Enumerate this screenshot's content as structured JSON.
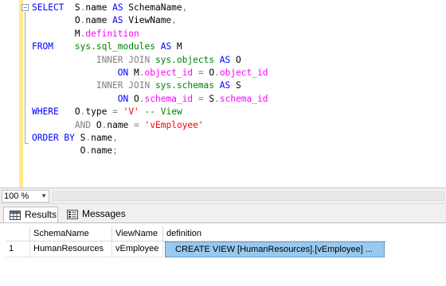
{
  "editor": {
    "lines": [
      [
        {
          "t": "SELECT",
          "c": "kw"
        },
        {
          "t": "  S",
          "c": "id"
        },
        {
          "t": ".",
          "c": "op"
        },
        {
          "t": "name ",
          "c": "id"
        },
        {
          "t": "AS",
          "c": "kw"
        },
        {
          "t": " SchemaName",
          "c": "id"
        },
        {
          "t": ",",
          "c": "op"
        }
      ],
      [
        {
          "t": "        O",
          "c": "id"
        },
        {
          "t": ".",
          "c": "op"
        },
        {
          "t": "name ",
          "c": "id"
        },
        {
          "t": "AS",
          "c": "kw"
        },
        {
          "t": " ViewName",
          "c": "id"
        },
        {
          "t": ",",
          "c": "op"
        }
      ],
      [
        {
          "t": "        M",
          "c": "id"
        },
        {
          "t": ".",
          "c": "op"
        },
        {
          "t": "definition",
          "c": "fn"
        }
      ],
      [
        {
          "t": "FROM",
          "c": "kw"
        },
        {
          "t": "    ",
          "c": "id"
        },
        {
          "t": "sys.sql_modules",
          "c": "sys"
        },
        {
          "t": " ",
          "c": "id"
        },
        {
          "t": "AS",
          "c": "kw"
        },
        {
          "t": " M",
          "c": "id"
        }
      ],
      [
        {
          "t": "            ",
          "c": "id"
        },
        {
          "t": "INNER JOIN",
          "c": "op"
        },
        {
          "t": " ",
          "c": "id"
        },
        {
          "t": "sys.objects",
          "c": "sys"
        },
        {
          "t": " ",
          "c": "id"
        },
        {
          "t": "AS",
          "c": "kw"
        },
        {
          "t": " O",
          "c": "id"
        }
      ],
      [
        {
          "t": "                ",
          "c": "id"
        },
        {
          "t": "ON",
          "c": "kw"
        },
        {
          "t": " M",
          "c": "id"
        },
        {
          "t": ".",
          "c": "op"
        },
        {
          "t": "object_id",
          "c": "fn"
        },
        {
          "t": " ",
          "c": "id"
        },
        {
          "t": "=",
          "c": "op"
        },
        {
          "t": " O",
          "c": "id"
        },
        {
          "t": ".",
          "c": "op"
        },
        {
          "t": "object_id",
          "c": "fn"
        }
      ],
      [
        {
          "t": "            ",
          "c": "id"
        },
        {
          "t": "INNER JOIN",
          "c": "op"
        },
        {
          "t": " ",
          "c": "id"
        },
        {
          "t": "sys.schemas",
          "c": "sys"
        },
        {
          "t": " ",
          "c": "id"
        },
        {
          "t": "AS",
          "c": "kw"
        },
        {
          "t": " S",
          "c": "id"
        }
      ],
      [
        {
          "t": "                ",
          "c": "id"
        },
        {
          "t": "ON",
          "c": "kw"
        },
        {
          "t": " O",
          "c": "id"
        },
        {
          "t": ".",
          "c": "op"
        },
        {
          "t": "schema_id",
          "c": "fn"
        },
        {
          "t": " ",
          "c": "id"
        },
        {
          "t": "=",
          "c": "op"
        },
        {
          "t": " S",
          "c": "id"
        },
        {
          "t": ".",
          "c": "op"
        },
        {
          "t": "schema_id",
          "c": "fn"
        }
      ],
      [
        {
          "t": "WHERE",
          "c": "kw"
        },
        {
          "t": "   O",
          "c": "id"
        },
        {
          "t": ".",
          "c": "op"
        },
        {
          "t": "type ",
          "c": "id"
        },
        {
          "t": "=",
          "c": "op"
        },
        {
          "t": " ",
          "c": "id"
        },
        {
          "t": "'V'",
          "c": "str"
        },
        {
          "t": " -- View",
          "c": "cmt"
        }
      ],
      [
        {
          "t": "        ",
          "c": "id"
        },
        {
          "t": "AND",
          "c": "op"
        },
        {
          "t": " O",
          "c": "id"
        },
        {
          "t": ".",
          "c": "op"
        },
        {
          "t": "name ",
          "c": "id"
        },
        {
          "t": "=",
          "c": "op"
        },
        {
          "t": " ",
          "c": "id"
        },
        {
          "t": "'vEmployee'",
          "c": "str"
        }
      ],
      [
        {
          "t": "ORDER BY",
          "c": "kw"
        },
        {
          "t": " S",
          "c": "id"
        },
        {
          "t": ".",
          "c": "op"
        },
        {
          "t": "name",
          "c": "id"
        },
        {
          "t": ",",
          "c": "op"
        }
      ],
      [
        {
          "t": "         O",
          "c": "id"
        },
        {
          "t": ".",
          "c": "op"
        },
        {
          "t": "name",
          "c": "id"
        },
        {
          "t": ";",
          "c": "op"
        }
      ]
    ]
  },
  "zoom": {
    "value": "100 %"
  },
  "tabs": {
    "results": "Results",
    "messages": "Messages"
  },
  "grid": {
    "columns": [
      "SchemaName",
      "ViewName",
      "definition"
    ],
    "rows": [
      {
        "num": "1",
        "cells": [
          "HumanResources",
          "vEmployee",
          "CREATE VIEW [HumanResources].[vEmployee]   ..."
        ]
      }
    ]
  },
  "colors": {
    "keyword": "#0000ff",
    "system_object": "#008000",
    "function": "#ff00ff",
    "string": "#ff0000",
    "selection": "#99c9ef"
  }
}
